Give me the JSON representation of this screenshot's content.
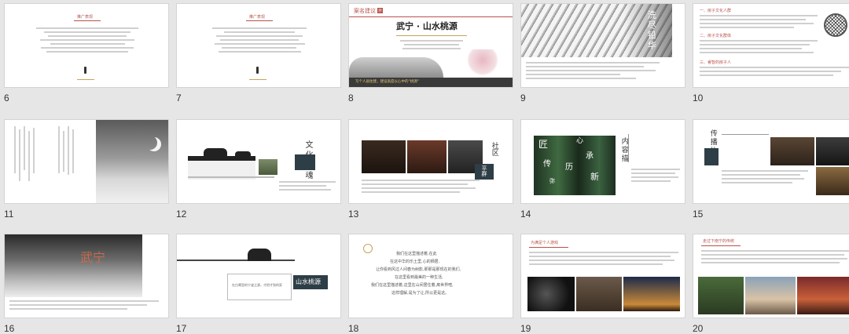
{
  "colors": {
    "accent": "#b8534a",
    "gold": "#c9a35a",
    "teal": "#2e3e46"
  },
  "slides": [
    {
      "number": "6",
      "title": "推广表现"
    },
    {
      "number": "7",
      "title": "推广表现"
    },
    {
      "number": "8",
      "tag": "案名建议",
      "title": "武宁 · 山水桃源",
      "stamp": "示",
      "tagline": "写个人居住建，建设高度以心中的“桃源”"
    },
    {
      "number": "9",
      "title": "洗尽铅华"
    },
    {
      "number": "10",
      "headings": [
        "一、房子文化人群",
        "二、房子文化群体",
        "三、睿智的房子人"
      ]
    },
    {
      "number": "11"
    },
    {
      "number": "12",
      "title": "文化入魂"
    },
    {
      "number": "13",
      "tag": "社区",
      "title": "平群"
    },
    {
      "number": "14",
      "words": [
        "匠",
        "心",
        "传",
        "承",
        "历",
        "新",
        "弥"
      ],
      "title": "内容描"
    },
    {
      "number": "15",
      "title": "传播执行"
    },
    {
      "number": "16",
      "title": "武宁"
    },
    {
      "number": "17",
      "title": "山水桃源",
      "caption": "在白鹭里的宁波之源，才把才到的家"
    },
    {
      "number": "18",
      "lines": [
        "我们在这里描述着,在此",
        "在这中华的乐土里,心的栖居,",
        "让你看到风过人间春为树影,那那是那现在的我们,",
        "在这里看到最美的一种生活,",
        "我们在这里描述着,这里在山间居住着,离世界喧,",
        "这样理解,是为了让,所以更是这。"
      ]
    },
    {
      "number": "19",
      "title": "为满足个人游戏"
    },
    {
      "number": "20",
      "title": "走过下南宁的传统"
    }
  ]
}
